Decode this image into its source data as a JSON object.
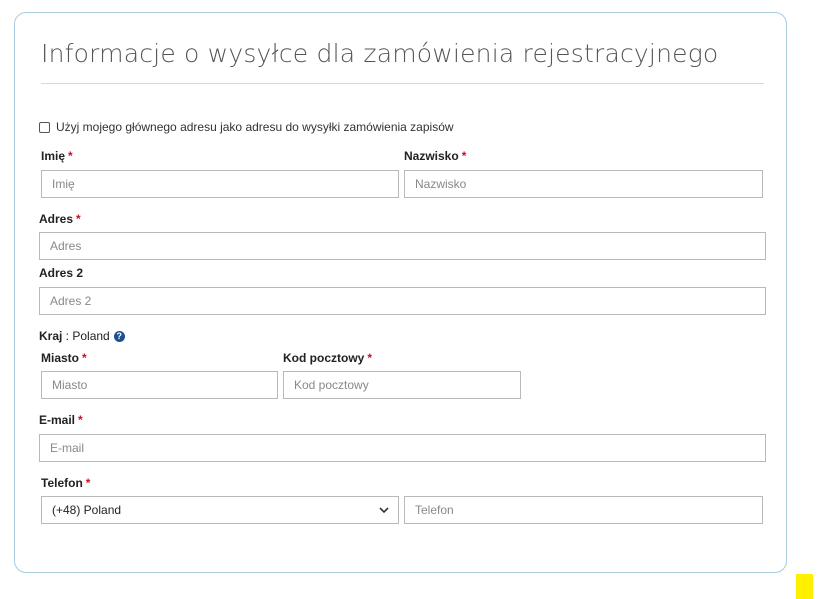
{
  "title": "Informacje o wysyłce dla zamówienia rejestracyjnego",
  "checkbox": {
    "label": "Użyj mojego głównego adresu jako adresu do wysyłki zamówienia zapisów",
    "checked": false
  },
  "required_mark": "*",
  "fields": {
    "first_name": {
      "label": "Imię",
      "placeholder": "Imię"
    },
    "last_name": {
      "label": "Nazwisko",
      "placeholder": "Nazwisko"
    },
    "address": {
      "label": "Adres",
      "placeholder": "Adres"
    },
    "address2": {
      "label": "Adres 2",
      "placeholder": "Adres 2"
    },
    "country": {
      "label": "Kraj",
      "separator": " : ",
      "value": "Poland",
      "help_icon": "?"
    },
    "city": {
      "label": "Miasto",
      "placeholder": "Miasto"
    },
    "postal": {
      "label": "Kod pocztowy",
      "placeholder": "Kod pocztowy"
    },
    "email": {
      "label": "E-mail",
      "placeholder": "E-mail"
    },
    "phone": {
      "label": "Telefon",
      "country_code": "(+48) Poland",
      "placeholder": "Telefon"
    }
  },
  "colors": {
    "border": "#a9cbe0",
    "required": "#c8102e",
    "help": "#1d4f91",
    "highlight": "#ffef00"
  }
}
